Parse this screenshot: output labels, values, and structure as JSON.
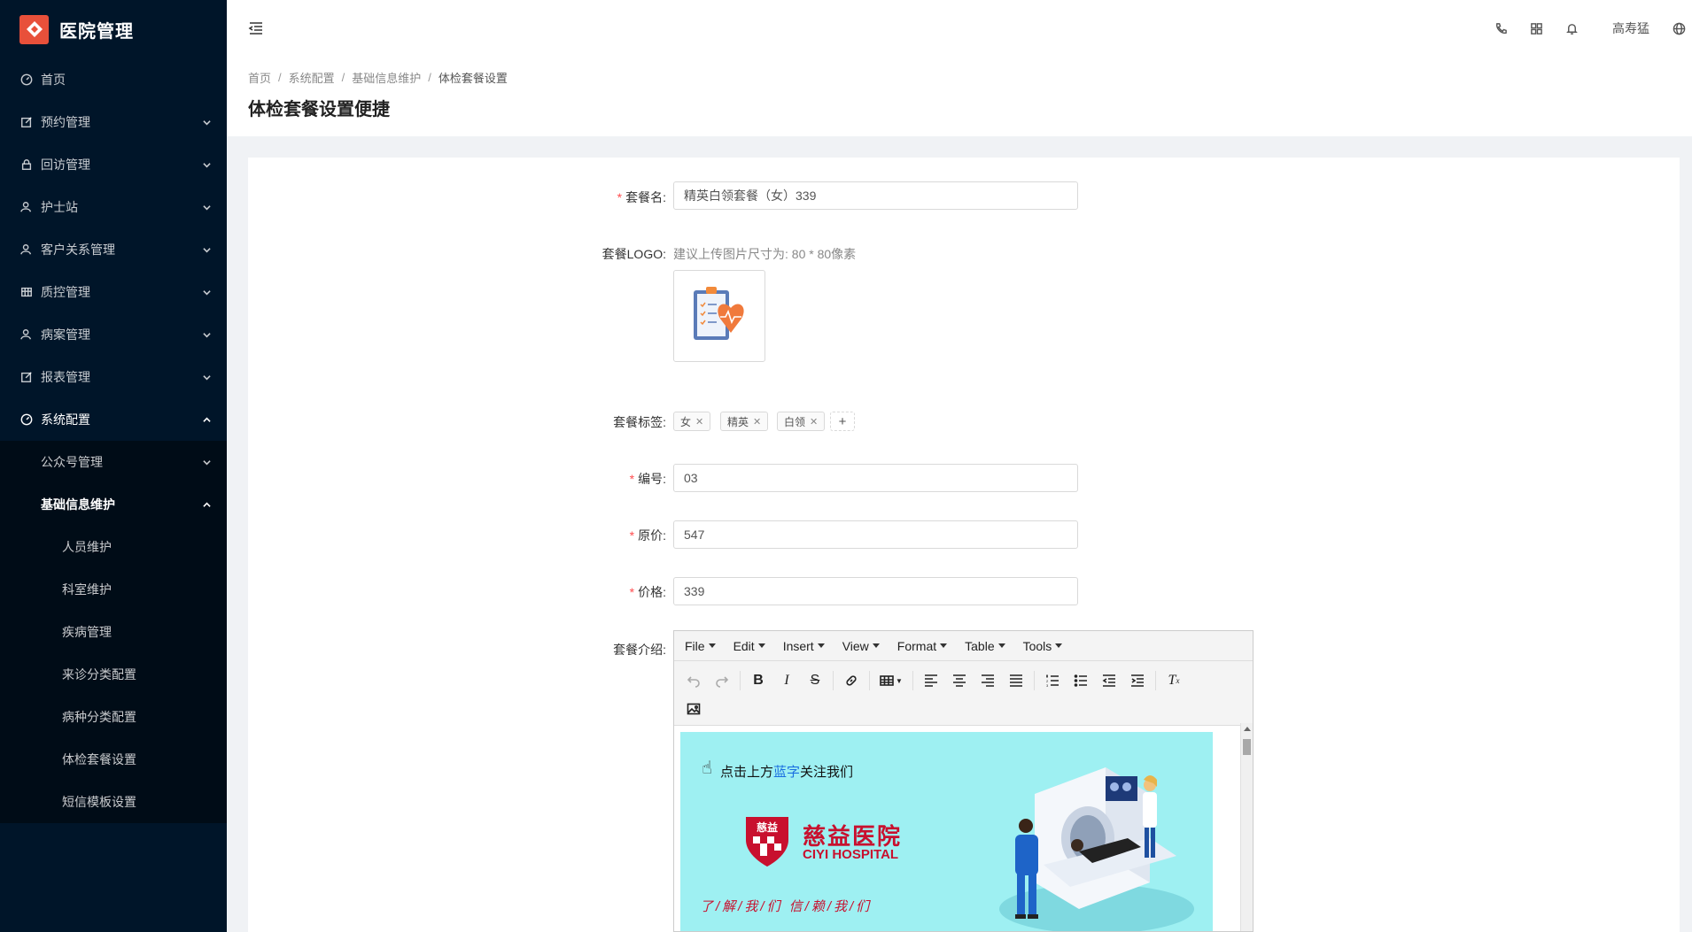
{
  "app": {
    "title": "医院管理"
  },
  "sidebar": {
    "items": [
      {
        "label": "首页",
        "icon": "dashboard-icon"
      },
      {
        "label": "预约管理",
        "icon": "edit-icon"
      },
      {
        "label": "回访管理",
        "icon": "lock-icon"
      },
      {
        "label": "护士站",
        "icon": "user-icon"
      },
      {
        "label": "客户关系管理",
        "icon": "user-icon"
      },
      {
        "label": "质控管理",
        "icon": "table-icon"
      },
      {
        "label": "病案管理",
        "icon": "user-icon"
      },
      {
        "label": "报表管理",
        "icon": "edit-icon"
      },
      {
        "label": "系统配置",
        "icon": "dashboard-icon"
      }
    ],
    "sub": {
      "wechat": "公众号管理",
      "basic": "基础信息维护",
      "leaves": [
        "人员维护",
        "科室维护",
        "疾病管理",
        "来诊分类配置",
        "病种分类配置",
        "体检套餐设置",
        "短信模板设置"
      ]
    }
  },
  "header": {
    "username": "高寿猛"
  },
  "breadcrumb": [
    "首页",
    "系统配置",
    "基础信息维护",
    "体检套餐设置"
  ],
  "page": {
    "title": "体检套餐设置便捷"
  },
  "form": {
    "name_label": "套餐名:",
    "name_value": "精英白领套餐（女）339",
    "logo_label": "套餐LOGO:",
    "logo_hint": "建议上传图片尺寸为: 80 * 80像素",
    "tags_label": "套餐标签:",
    "tags": [
      "女",
      "精英",
      "白领"
    ],
    "code_label": "编号:",
    "code_value": "03",
    "orig_label": "原价:",
    "orig_value": "547",
    "price_label": "价格:",
    "price_value": "339",
    "intro_label": "套餐介绍:"
  },
  "editor": {
    "menus": [
      "File",
      "Edit",
      "Insert",
      "View",
      "Format",
      "Table",
      "Tools"
    ],
    "content": {
      "prefix": "点击上方",
      "blue": "蓝字",
      "suffix": "关注我们",
      "brand_cn": "慈益医院",
      "brand_en": "CIYI HOSPITAL",
      "badge": "慈益",
      "slogan": "了/解/我/们   信/赖/我/们"
    }
  },
  "colors": {
    "sidebar": "#001529",
    "accent": "#e8503a",
    "required": "#ff4d4f",
    "brand": "#c8102e",
    "banner": "#9ef0f2"
  }
}
